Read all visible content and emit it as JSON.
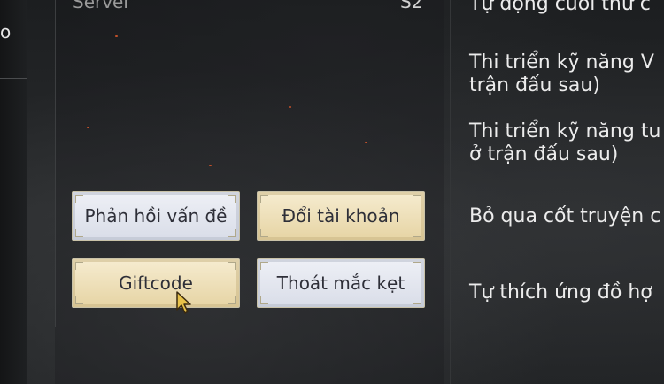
{
  "left_panel": {
    "partial_text": "o"
  },
  "server": {
    "label": "Server",
    "value": "S2"
  },
  "buttons": {
    "feedback": "Phản hồi vấn đề",
    "switch_account": "Đổi tài khoản",
    "giftcode": "Giftcode",
    "unstuck": "Thoát mắc kẹt"
  },
  "options": {
    "auto_end": "Tự động cuối thứ c",
    "skill_v_line1": "Thi triển kỹ năng V",
    "skill_v_line2": "trận đấu sau)",
    "skill_t_line1": "Thi triển kỹ năng tu",
    "skill_t_line2": "ở trận đấu sau)",
    "skip_story": "Bỏ qua cốt truyện c",
    "auto_equip": "Tự thích ứng đồ hợ"
  },
  "colors": {
    "button_blue": "#e4e7ef",
    "button_gold": "#eee0b8",
    "button_text": "#2e2f38",
    "option_text": "#ececec"
  },
  "icons": {
    "cursor": "arrow-cursor-icon"
  }
}
